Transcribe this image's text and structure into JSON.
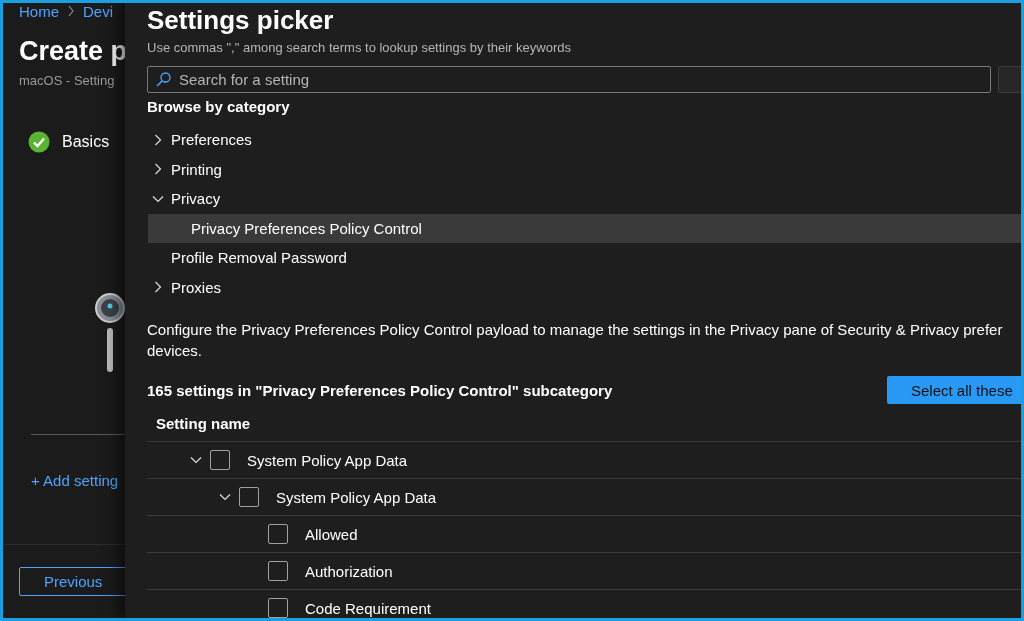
{
  "background_page": {
    "breadcrumb": [
      "Home",
      "Devi"
    ],
    "title": "Create p",
    "subtitle": "macOS - Setting",
    "steps": [
      {
        "label": "Basics",
        "done": true
      }
    ],
    "add_link": "+ Add setting",
    "previous_button": "Previous"
  },
  "picker": {
    "title": "Settings picker",
    "hint": "Use commas \",\" among search terms to lookup settings by their keywords",
    "search": {
      "placeholder": "Search for a setting"
    },
    "browse_heading": "Browse by category",
    "categories": [
      {
        "label": "Preferences",
        "kind": "folder",
        "expanded": false,
        "selected": false
      },
      {
        "label": "Printing",
        "kind": "folder",
        "expanded": false,
        "selected": false
      },
      {
        "label": "Privacy",
        "kind": "folder",
        "expanded": true,
        "selected": false,
        "children": [
          {
            "label": "Privacy Preferences Policy Control",
            "kind": "leaf",
            "selected": true
          }
        ]
      },
      {
        "label": "Profile Removal Password",
        "kind": "leaf",
        "selected": false
      },
      {
        "label": "Proxies",
        "kind": "folder",
        "expanded": false,
        "selected": false
      }
    ],
    "description": [
      "Configure the Privacy Preferences Policy Control payload to manage the settings in the Privacy pane of Security & Privacy prefer",
      "devices."
    ],
    "count": "165 settings in \"Privacy Preferences Policy Control\" subcategory",
    "select_all_button": "Select all these",
    "table": {
      "columns": [
        "Setting name"
      ],
      "rows": [
        {
          "label": "System Policy App Data",
          "checked": false,
          "expanded": true,
          "children": [
            {
              "label": "System Policy App Data",
              "checked": false,
              "expanded": true,
              "children": [
                {
                  "label": "Allowed",
                  "checked": false
                },
                {
                  "label": "Authorization",
                  "checked": false
                },
                {
                  "label": "Code Requirement",
                  "checked": false
                }
              ]
            }
          ]
        }
      ]
    }
  }
}
